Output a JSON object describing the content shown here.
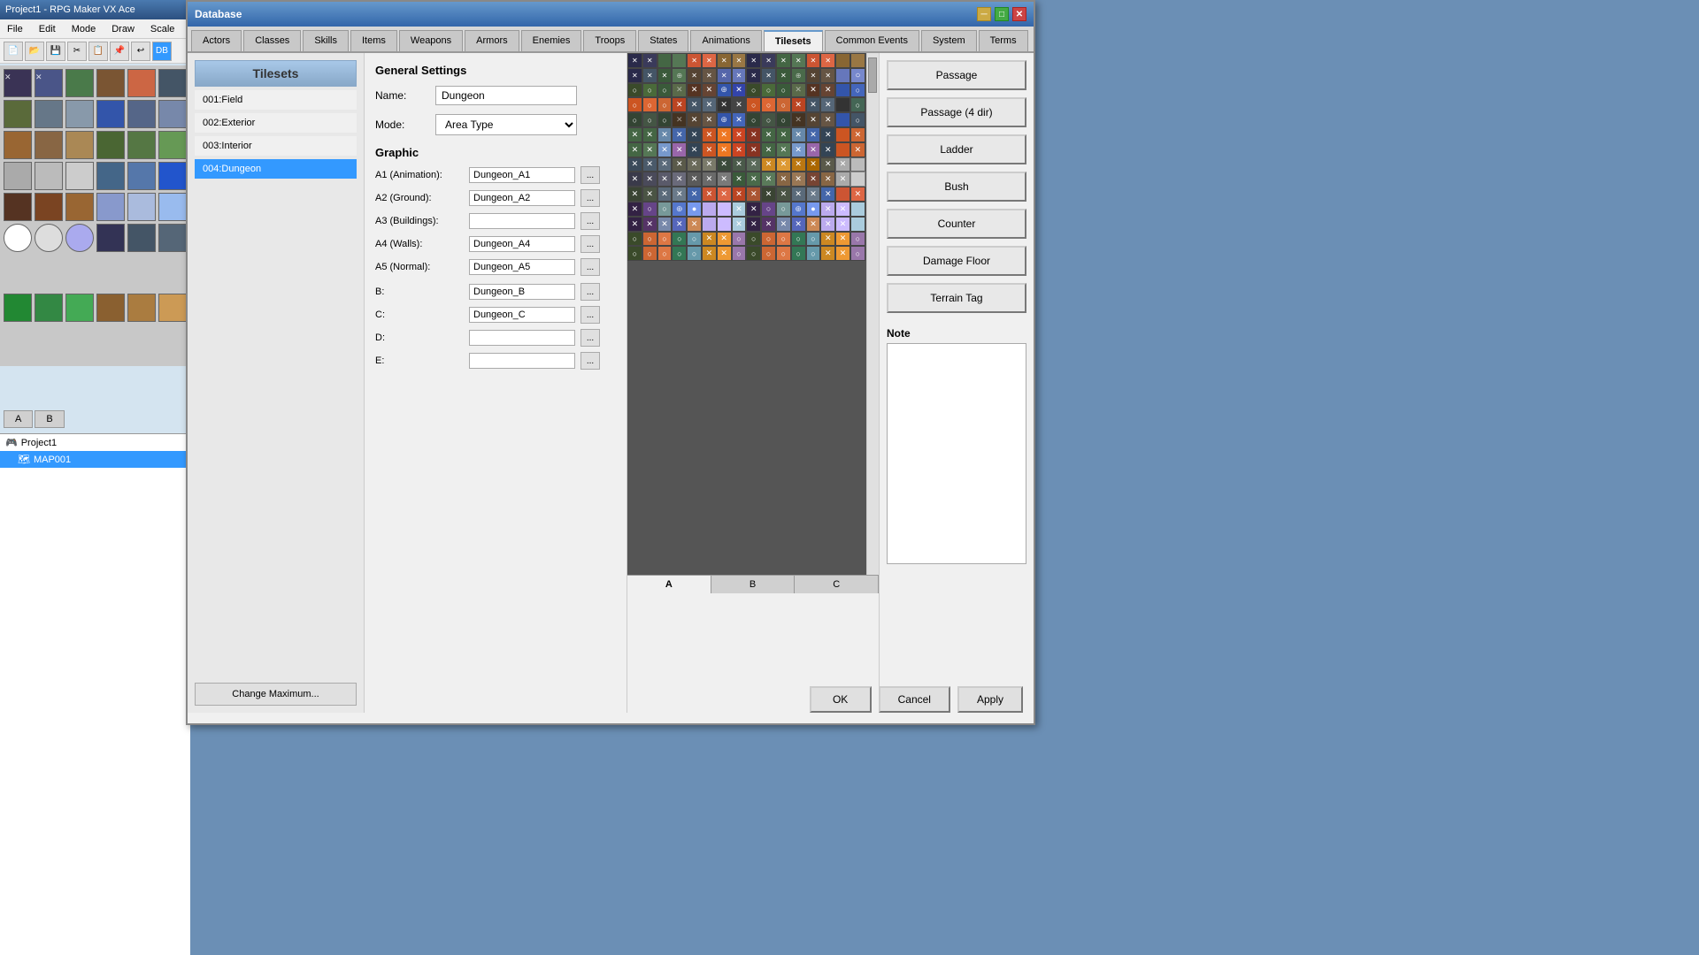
{
  "app": {
    "title": "Project1 - RPG Maker VX Ace",
    "window_title": "Database"
  },
  "menu": {
    "items": [
      "File",
      "Edit",
      "Mode",
      "Draw",
      "Scale"
    ]
  },
  "db_tabs": [
    {
      "label": "Actors",
      "active": false
    },
    {
      "label": "Classes",
      "active": false
    },
    {
      "label": "Skills",
      "active": false
    },
    {
      "label": "Items",
      "active": false
    },
    {
      "label": "Weapons",
      "active": false
    },
    {
      "label": "Armors",
      "active": false
    },
    {
      "label": "Enemies",
      "active": false
    },
    {
      "label": "Troops",
      "active": false
    },
    {
      "label": "States",
      "active": false
    },
    {
      "label": "Animations",
      "active": false
    },
    {
      "label": "Tilesets",
      "active": true
    },
    {
      "label": "Common Events",
      "active": false
    },
    {
      "label": "System",
      "active": false
    },
    {
      "label": "Terms",
      "active": false
    }
  ],
  "tilesets_title": "Tilesets",
  "tileset_list": [
    {
      "id": "001",
      "name": "Field",
      "label": "001:Field"
    },
    {
      "id": "002",
      "name": "Exterior",
      "label": "002:Exterior"
    },
    {
      "id": "003",
      "name": "Interior",
      "label": "003:Interior"
    },
    {
      "id": "004",
      "name": "Dungeon",
      "label": "004:Dungeon",
      "selected": true
    }
  ],
  "general_settings_title": "General Settings",
  "name_label": "Name:",
  "name_value": "Dungeon",
  "mode_label": "Mode:",
  "mode_value": "Area Type",
  "graphic_title": "Graphic",
  "a1_label": "A1 (Animation):",
  "a1_value": "Dungeon_A1",
  "a2_label": "A2 (Ground):",
  "a2_value": "Dungeon_A2",
  "a3_label": "A3 (Buildings):",
  "a3_value": "",
  "a4_label": "A4 (Walls):",
  "a4_value": "Dungeon_A4",
  "a5_label": "A5 (Normal):",
  "a5_value": "Dungeon_A5",
  "b_label": "B:",
  "b_value": "Dungeon_B",
  "c_label": "C:",
  "c_value": "Dungeon_C",
  "d_label": "D:",
  "d_value": "",
  "e_label": "E:",
  "e_value": "",
  "buttons": {
    "passage": "Passage",
    "passage4": "Passage (4 dir)",
    "ladder": "Ladder",
    "bush": "Bush",
    "counter": "Counter",
    "damage_floor": "Damage Floor",
    "terrain_tag": "Terrain Tag"
  },
  "note_label": "Note",
  "note_value": "",
  "tile_tabs": [
    {
      "label": "A",
      "active": true
    },
    {
      "label": "B",
      "active": false
    },
    {
      "label": "C",
      "active": false
    }
  ],
  "bottom_buttons": {
    "ok": "OK",
    "cancel": "Cancel",
    "apply": "Apply"
  },
  "change_max": "Change Maximum...",
  "left_tabs": [
    {
      "label": "A",
      "active": false
    },
    {
      "label": "B",
      "active": false
    }
  ],
  "project_label": "Project1",
  "map_label": "MAP001",
  "browse_label": "..."
}
